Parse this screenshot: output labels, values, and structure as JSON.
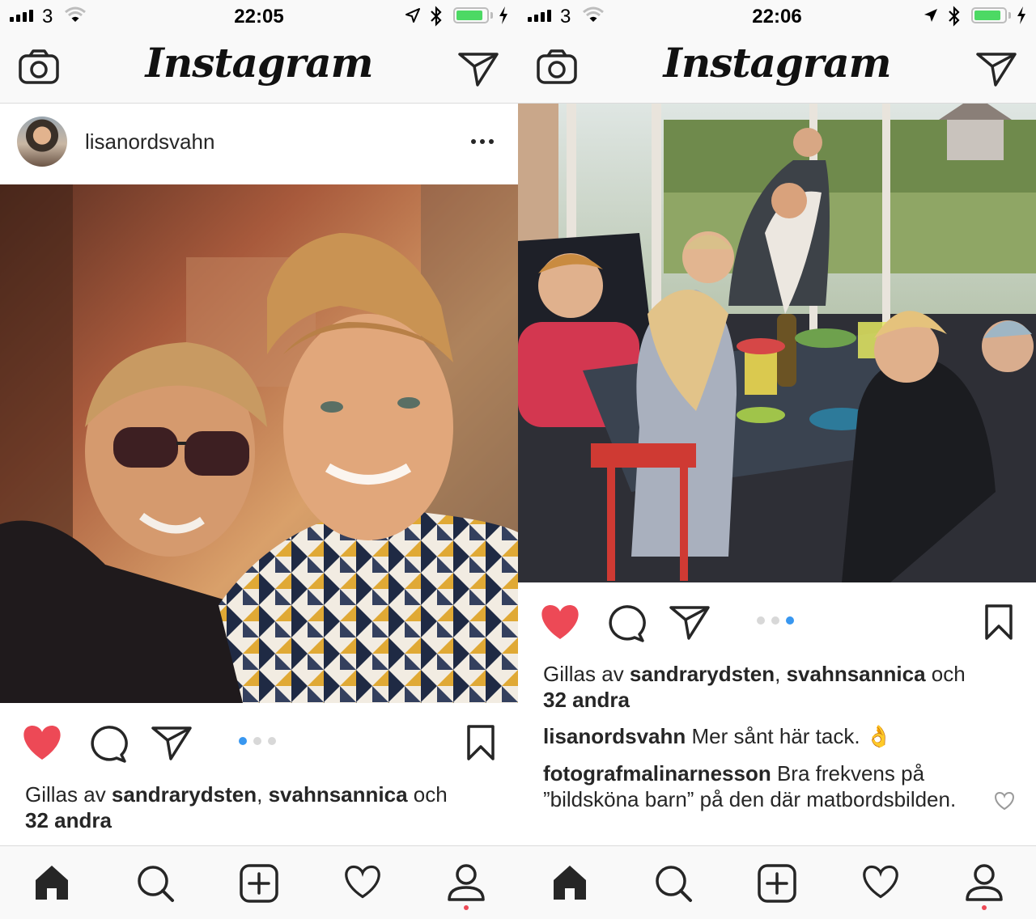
{
  "left": {
    "status": {
      "carrier": "3",
      "time": "22:05",
      "battery_level": 0.8
    },
    "nav": {
      "logo": "Instagram"
    },
    "post": {
      "username": "lisanordsvahn"
    },
    "carousel": {
      "count": 3,
      "active": 0
    },
    "likes": {
      "prefix": "Gillas av ",
      "user1": "sandrarydsten",
      "sep": ", ",
      "user2": "svahnsannica",
      "mid": " och",
      "others": "32 andra"
    }
  },
  "right": {
    "status": {
      "carrier": "3",
      "time": "22:06",
      "battery_level": 0.8
    },
    "nav": {
      "logo": "Instagram"
    },
    "carousel": {
      "count": 3,
      "active": 2
    },
    "likes": {
      "prefix": "Gillas av ",
      "user1": "sandrarydsten",
      "sep": ", ",
      "user2": "svahnsannica",
      "mid": " och",
      "others": "32 andra"
    },
    "comments": [
      {
        "user": "lisanordsvahn",
        "text": " Mer sånt här tack. 👌"
      },
      {
        "user": "fotografmalinarnesson",
        "text": " Bra frekvens på ”bildsköna barn” på den där matbordsbilden."
      }
    ]
  },
  "icons": {
    "camera": "camera-icon",
    "direct": "paper-plane-icon",
    "heart": "heart-icon",
    "comment": "comment-bubble-icon",
    "bookmark": "bookmark-icon",
    "home": "home-icon",
    "search": "search-icon",
    "add": "plus-square-icon",
    "activity": "heart-outline-icon",
    "profile": "profile-icon"
  },
  "colors": {
    "like_red": "#ed4956",
    "dot_active": "#3897f0",
    "dot_inactive": "#d8d8d8",
    "battery_green": "#4cd964"
  }
}
